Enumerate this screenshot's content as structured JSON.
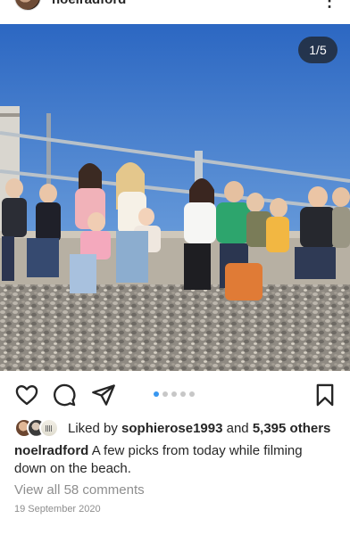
{
  "post": {
    "username": "noelradford",
    "more_icon": "more-vertical-icon",
    "image_counter": "1/5",
    "carousel": {
      "total": 5,
      "active_index": 0
    },
    "actions": {
      "like_icon": "heart-icon",
      "comment_icon": "comment-icon",
      "share_icon": "send-icon",
      "save_icon": "bookmark-icon"
    },
    "likes": {
      "prefix": "Liked by",
      "user": "sophierose1993",
      "middle": "and",
      "others": "5,395 others"
    },
    "caption": {
      "username": "noelradford",
      "text": "A few picks from today while filming down on the beach."
    },
    "comments_link": "View all 58 comments",
    "date": "19 September 2020"
  },
  "colors": {
    "sky_top": "#2c67c2",
    "sky_bottom": "#7fb3e6",
    "link_blue": "#3897f0",
    "secondary_text": "#8e8e8e",
    "primary_text": "#262626"
  }
}
